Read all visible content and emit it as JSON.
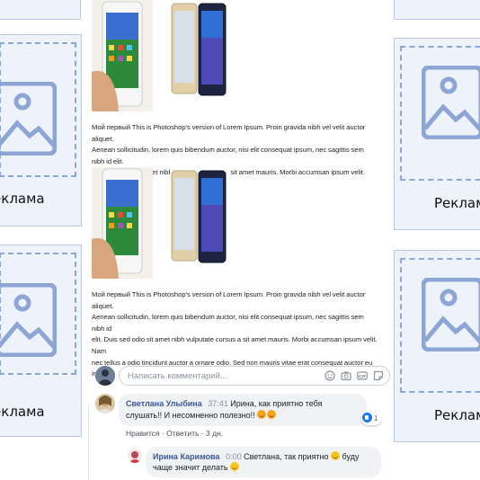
{
  "ads": {
    "label": "Реклама",
    "colors": {
      "background": "#eef2fa",
      "border": "#b9c9e6",
      "frame": "#8da6d6"
    },
    "icon": "image-placeholder-icon"
  },
  "post": {
    "images_a": [
      "phone-white-android",
      "phone-samsung-pair"
    ],
    "paragraph1": [
      "Мой первый This is Photoshop's version  of Lorem Ipsum. Proin gravida nibh vel velit auctor aliquet.",
      "Aenean sollicitudin, lorem quis bibendum auctor, nisi elit consequat ipsum, nec sagittis sem nibh id elit.",
      "Duis sed odio sit amet nibh vulputate cursus a sit amet mauris. Morbi accumsan ipsum velit. Nam nec"
    ],
    "images_b": [
      "phone-white-android",
      "phone-samsung-pair"
    ],
    "paragraph2": [
      "Мой первый This is Photoshop's version  of Lorem Ipsum. Proin gravida nibh vel velit auctor aliquet.",
      "Aenean sollicitudin, lorem quis bibendum auctor, nisi elit consequat ipsum, nec sagittis sem nibh id",
      "elit. Duis sed odio sit amet nibh vulputate cursus a sit amet mauris. Morbi accumsan ipsum velit. Nam",
      "nec tellus a odio tincidunt auctor a ornare odio. Sed non  mauris vitae erat consequat auctor eu in elit."
    ]
  },
  "comments": {
    "input_placeholder": "Написать комментарий...",
    "input_icons": [
      "emoji-icon",
      "camera-icon",
      "gif-icon",
      "sticker-icon"
    ],
    "first": {
      "author": "Светлана Улыбина",
      "time": "37:41",
      "text_line1": "Ирина, как приятно тебя",
      "text_line2": "слушать!! И несомненно полезно!!",
      "likes": "1",
      "action_like": "Нравится",
      "action_reply": "Ответить",
      "separator": "·",
      "age": "3 дн."
    },
    "reply": {
      "author": "Ирина Каримова",
      "time": "0:00",
      "text_line1": "Светлана, так приятно",
      "text_line1b": "буду",
      "text_line2": "чаще значит делать"
    }
  }
}
